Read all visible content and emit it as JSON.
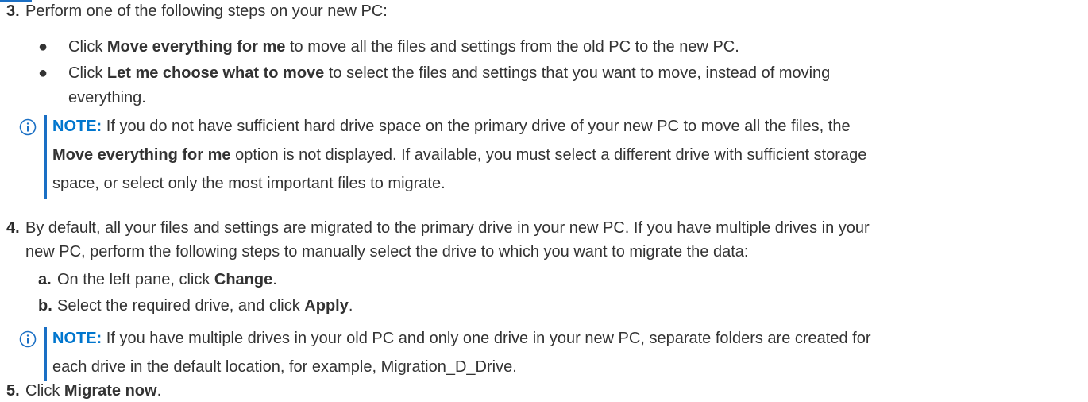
{
  "steps": {
    "s3": {
      "number": "3.",
      "text": "Perform one of the following steps on your new PC:",
      "bullets": [
        {
          "bold": "Move everything for me",
          "prefix": "Click ",
          "suffix": " to move all the files and settings from the old PC to the new PC."
        },
        {
          "bold": "Let me choose what to move",
          "prefix": "Click ",
          "suffix_line1": " to select the files and settings that you want to move, instead of moving",
          "suffix_line2": "everything."
        }
      ],
      "note": {
        "label": "NOTE:",
        "line1": " If you do not have sufficient hard drive space on the primary drive of your new PC to move all the files, the",
        "bold": "Move everything for me",
        "line2_suffix": " option is not displayed. If available, you must select a different drive with sufficient storage",
        "line3": "space, or select only the most important files to migrate."
      }
    },
    "s4": {
      "number": "4.",
      "line1": "By default, all your files and settings are migrated to the primary drive in your new PC. If you have multiple drives in your",
      "line2": "new PC, perform the following steps to manually select the drive to which you want to migrate the data:",
      "subs": [
        {
          "letter": "a.",
          "prefix": "On the left pane, click ",
          "bold": "Change",
          "suffix": "."
        },
        {
          "letter": "b.",
          "prefix": "Select the required drive, and click ",
          "bold": "Apply",
          "suffix": "."
        }
      ],
      "note": {
        "label": "NOTE:",
        "line1": " If you have multiple drives in your old PC and only one drive in your new PC, separate folders are created for",
        "line2": "each drive in the default location, for example, Migration_D_Drive."
      }
    },
    "s5": {
      "number": "5.",
      "prefix": "Click ",
      "bold": "Migrate now",
      "suffix": "."
    }
  },
  "colors": {
    "accent": "#0076ce",
    "bar": "#1a6fc4",
    "text": "#333333"
  },
  "icons": {
    "note": "info-circle-icon"
  }
}
